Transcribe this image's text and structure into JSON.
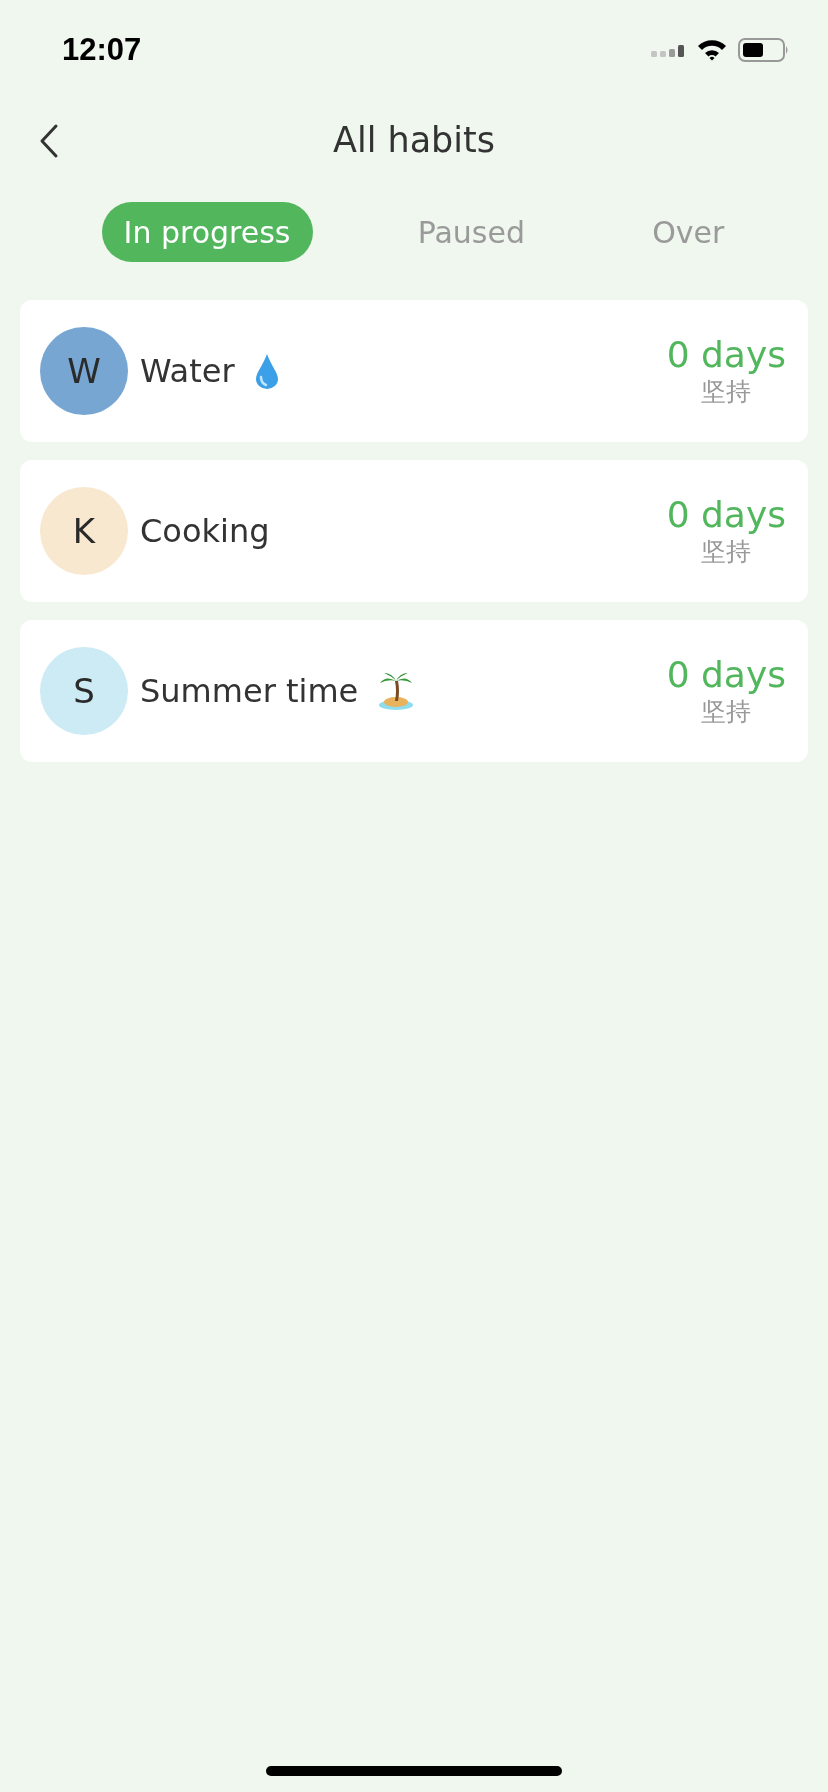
{
  "status_bar": {
    "time": "12:07"
  },
  "header": {
    "title": "All habits"
  },
  "tabs": [
    {
      "label": "In progress",
      "selected": true
    },
    {
      "label": "Paused",
      "selected": false
    },
    {
      "label": "Over",
      "selected": false
    }
  ],
  "habits": [
    {
      "initial": "W",
      "name": "Water",
      "kind": "drop",
      "color": "#77a6d3",
      "days": "0 days",
      "caption": "坚持"
    },
    {
      "initial": "K",
      "name": "Cooking",
      "kind": "plain",
      "color": "#f9e8d0",
      "days": "0 days",
      "caption": "坚持"
    },
    {
      "initial": "S",
      "name": "Summer time",
      "kind": "island",
      "color": "#cdebf4",
      "days": "0 days",
      "caption": "坚持"
    }
  ]
}
